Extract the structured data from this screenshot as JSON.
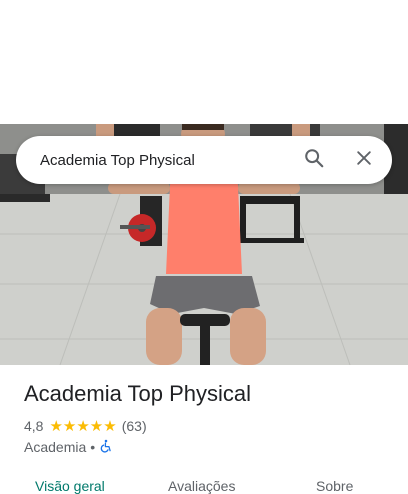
{
  "search": {
    "query": "Academia Top Physical"
  },
  "place": {
    "name": "Academia Top Physical",
    "rating": "4,8",
    "stars": "★★★★★",
    "review_count": "(63)",
    "category": "Academia",
    "separator": "•"
  },
  "tabs": [
    {
      "label": "Visão geral",
      "active": true
    },
    {
      "label": "Avaliações",
      "active": false
    },
    {
      "label": "Sobre",
      "active": false
    }
  ],
  "colors": {
    "accent": "#00796b",
    "stars": "#fbbc04",
    "accessibility": "#1a73e8"
  },
  "icons": {
    "search": "search-icon",
    "close": "close-icon",
    "accessibility": "wheelchair-icon"
  }
}
